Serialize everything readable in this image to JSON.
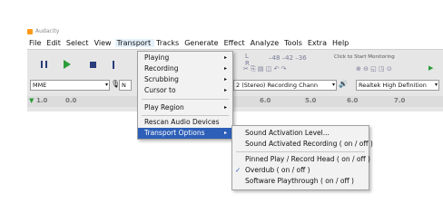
{
  "window": {
    "title": "Audacity"
  },
  "menubar": [
    "File",
    "Edit",
    "Select",
    "View",
    "Transport",
    "Tracks",
    "Generate",
    "Effect",
    "Analyze",
    "Tools",
    "Extra",
    "Help"
  ],
  "toolbar": {
    "monitor_hint": "Click to Start Monitoring",
    "host": "MME",
    "input_device_partial": "N",
    "channels": "2 (Stereo) Recording Chann",
    "output_device": "Realtek High Definition",
    "meter_l": "L",
    "meter_r": "R"
  },
  "ruler_ticks": [
    "1.0",
    "0.0",
    "6.0",
    "5.0",
    "6.0",
    "7.0"
  ],
  "transport_menu": {
    "items": [
      "Playing",
      "Recording",
      "Scrubbing",
      "Cursor to",
      "Play Region",
      "Rescan Audio Devices",
      "Transport Options"
    ],
    "submenu_arrow": "▸"
  },
  "transport_options_menu": {
    "items": [
      "Sound Activation Level...",
      "Sound Activated Recording ( on / off )",
      "Pinned Play / Record Head ( on / off )",
      "Overdub ( on / off )",
      "Software Playthrough ( on / off )"
    ],
    "checkmark": "✓"
  },
  "colors": {
    "highlight": "#2d5fb8",
    "menu_bg": "#f2f2f2",
    "toolbar_bg": "#e6e6e6"
  }
}
